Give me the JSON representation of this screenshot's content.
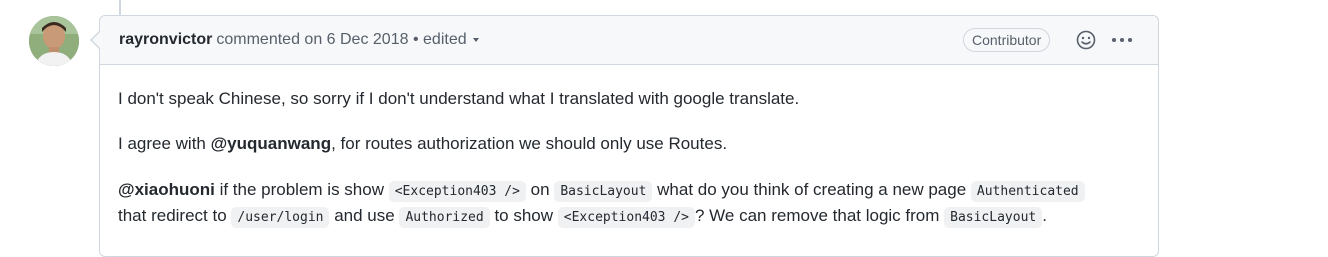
{
  "comment": {
    "author": "rayronvictor",
    "action_text": "commented on 6 Dec 2018",
    "separator": "•",
    "edited_label": "edited",
    "badge": "Contributor",
    "reaction_icon": "smiley-icon",
    "menu_icon": "kebab-horizontal-icon",
    "paragraphs": {
      "p1": "I don't speak Chinese, so sorry if I don't understand what I translated with google translate.",
      "p2_pre": "I agree with ",
      "p2_mention": "@yuquanwang",
      "p2_post": ", for routes authorization we should only use Routes.",
      "p3_mention": "@xiaohuoni",
      "p3_t1": " if the problem is show ",
      "p3_code1": "<Exception403 />",
      "p3_t2": " on ",
      "p3_code2": "BasicLayout",
      "p3_t3": " what do you think of creating a new page ",
      "p3_code3": "Authenticated",
      "p4_t1": "that redirect to ",
      "p4_code1": "/user/login",
      "p4_t2": " and use ",
      "p4_code2": "Authorized",
      "p4_t3": " to show ",
      "p4_code3": "<Exception403 />",
      "p4_t4": "? We can remove that logic from ",
      "p4_code4": "BasicLayout",
      "p4_t5": "."
    }
  },
  "colors": {
    "border": "#d0d7de",
    "header_bg": "#f6f8fa",
    "text": "#24292f",
    "muted": "#57606a",
    "code_bg": "#eff1f3"
  }
}
